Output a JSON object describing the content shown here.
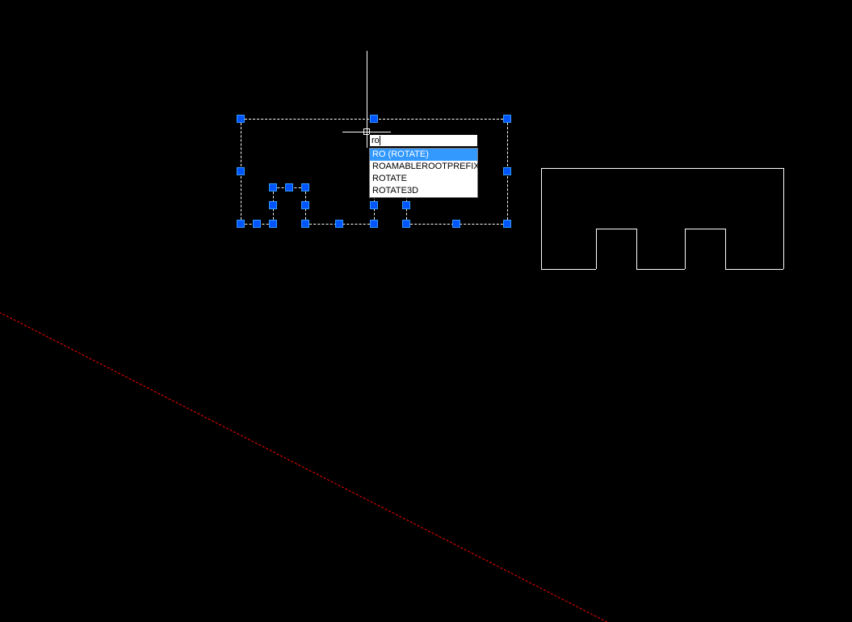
{
  "command_input": {
    "value": "ro"
  },
  "autocomplete": {
    "items": [
      {
        "label": "RO (ROTATE)",
        "highlighted": true
      },
      {
        "label": "ROAMABLEROOTPREFIX",
        "highlighted": false
      },
      {
        "label": "ROTATE",
        "highlighted": false
      },
      {
        "label": "ROTATE3D",
        "highlighted": false
      }
    ]
  }
}
